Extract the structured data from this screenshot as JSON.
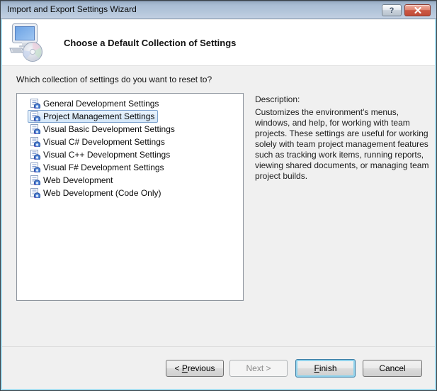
{
  "titlebar": {
    "title": "Import and Export Settings Wizard",
    "help_glyph": "?"
  },
  "header": {
    "title": "Choose a Default Collection of Settings"
  },
  "main": {
    "question": "Which collection of settings do you want to reset to?",
    "settings_list": [
      {
        "label": "General Development Settings",
        "selected": false
      },
      {
        "label": "Project Management Settings",
        "selected": true
      },
      {
        "label": "Visual Basic Development Settings",
        "selected": false
      },
      {
        "label": "Visual C# Development Settings",
        "selected": false
      },
      {
        "label": "Visual C++ Development Settings",
        "selected": false
      },
      {
        "label": "Visual F# Development Settings",
        "selected": false
      },
      {
        "label": "Web Development",
        "selected": false
      },
      {
        "label": "Web Development (Code Only)",
        "selected": false
      }
    ],
    "description_heading": "Description:",
    "description_body": "Customizes the environment's menus, windows, and help, for working with team projects. These settings are useful for working solely with team project management features such as tracking work items, running reports, viewing shared documents, or managing team project builds."
  },
  "footer": {
    "previous": {
      "pre": "< ",
      "mnemonic": "P",
      "rest": "revious"
    },
    "next": {
      "label": "Next >",
      "disabled": true
    },
    "finish": {
      "mnemonic": "F",
      "rest": "inish",
      "default": true
    },
    "cancel": {
      "label": "Cancel"
    }
  },
  "colors": {
    "selection_bg": "#d3e6f8",
    "selection_border": "#7da2ce",
    "focus_ring": "#8fd2ec",
    "close_button_red": "#c14b38",
    "titlebar_top": "#a9bdd4",
    "titlebar_bottom": "#c2d0e2",
    "window_frame": "#a6dcee"
  }
}
